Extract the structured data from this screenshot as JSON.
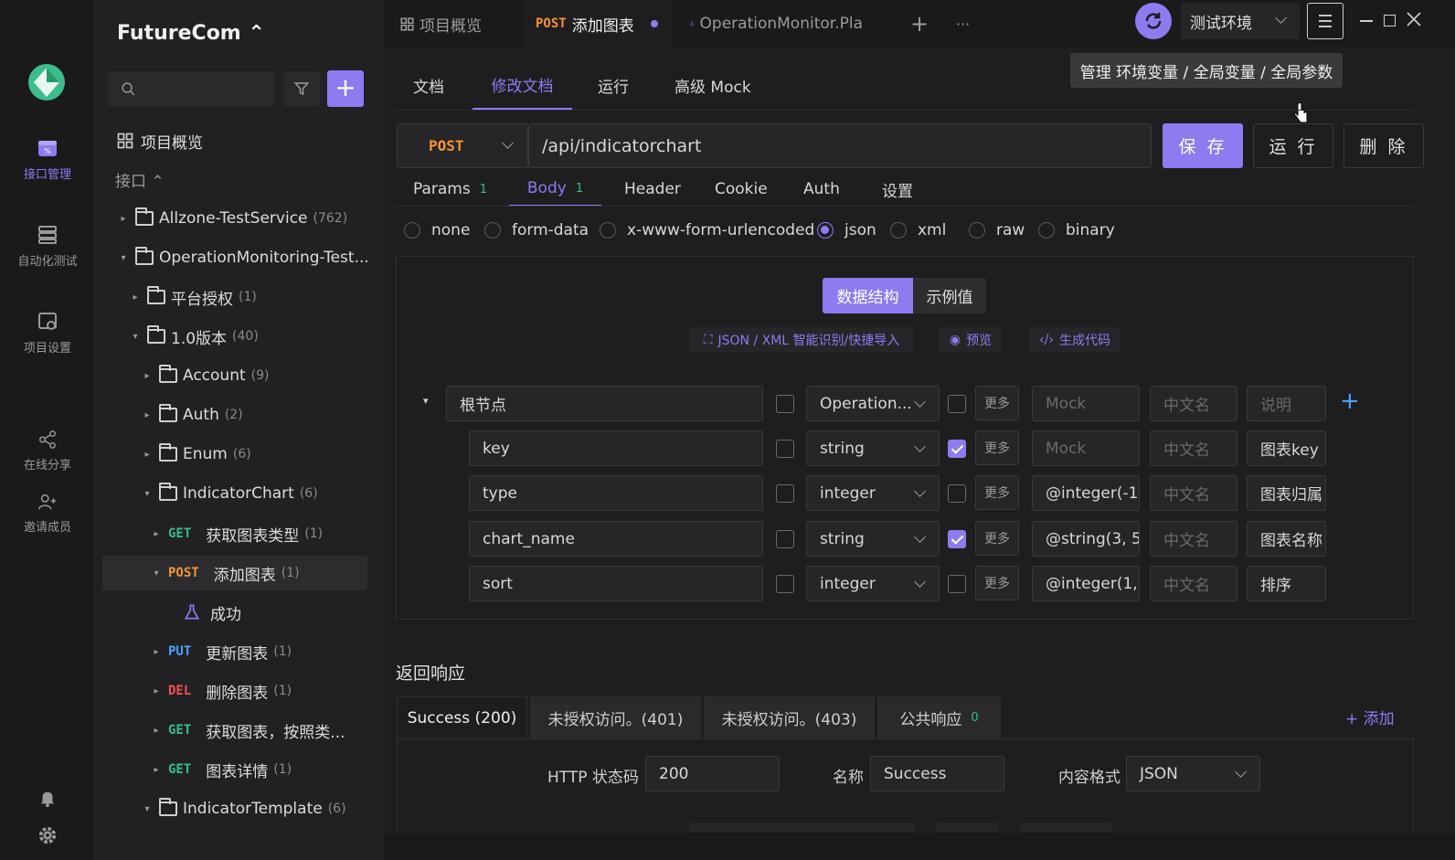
{
  "leftbar": {
    "items": [
      {
        "label": "接口管理",
        "icon": "api-management-icon"
      },
      {
        "label": "自动化测试",
        "icon": "automation-test-icon"
      },
      {
        "label": "项目设置",
        "icon": "project-settings-icon"
      },
      {
        "label": "在线分享",
        "icon": "share-icon"
      },
      {
        "label": "邀请成员",
        "icon": "invite-member-icon"
      }
    ]
  },
  "tree": {
    "project_name": "FutureCom ⌃",
    "search_placeholder": "",
    "overview": "项目概览",
    "api_section": "接口 ⌃",
    "rows": [
      {
        "kind": "folder",
        "arrow": "▸",
        "label": "Allzone-TestService",
        "count": "(762)"
      },
      {
        "kind": "folder",
        "arrow": "▾",
        "label": "OperationMonitoring-Test...",
        "count": ""
      },
      {
        "kind": "folder",
        "arrow": "▸",
        "label": "平台授权",
        "count": "(1)"
      },
      {
        "kind": "folder",
        "arrow": "▾",
        "label": "1.0版本",
        "count": "(40)"
      },
      {
        "kind": "folder",
        "arrow": "▸",
        "label": "Account",
        "count": "(9)"
      },
      {
        "kind": "folder",
        "arrow": "▸",
        "label": "Auth",
        "count": "(2)"
      },
      {
        "kind": "folder",
        "arrow": "▸",
        "label": "Enum",
        "count": "(6)"
      },
      {
        "kind": "folder",
        "arrow": "▾",
        "label": "IndicatorChart",
        "count": "(6)"
      },
      {
        "kind": "api",
        "arrow": "▸",
        "method": "GET",
        "label": "获取图表类型",
        "count": "(1)"
      },
      {
        "kind": "api",
        "arrow": "▾",
        "method": "POST",
        "label": "添加图表",
        "count": "(1)"
      },
      {
        "kind": "case",
        "arrow": "",
        "label": "成功",
        "count": ""
      },
      {
        "kind": "api",
        "arrow": "▸",
        "method": "PUT",
        "label": "更新图表",
        "count": "(1)"
      },
      {
        "kind": "api",
        "arrow": "▸",
        "method": "DEL",
        "label": "删除图表",
        "count": "(1)"
      },
      {
        "kind": "api",
        "arrow": "▸",
        "method": "GET",
        "label": "获取图表，按照类...",
        "count": ""
      },
      {
        "kind": "api",
        "arrow": "▸",
        "method": "GET",
        "label": "图表详情",
        "count": "(1)"
      },
      {
        "kind": "folder",
        "arrow": "▾",
        "label": "IndicatorTemplate",
        "count": "(6)"
      }
    ]
  },
  "tabs": {
    "t1": "项目概览",
    "t2_method": "POST",
    "t2_label": "添加图表",
    "t3": "OperationMonitor.Pla",
    "add": "+",
    "more": "···"
  },
  "env": {
    "name": "测试环境",
    "tooltip": "管理 环境变量 / 全局变量 / 全局参数"
  },
  "subtabs": [
    "文档",
    "修改文档",
    "运行",
    "高级 Mock"
  ],
  "request": {
    "method": "POST",
    "url": "/api/indicatorchart",
    "save": "保 存",
    "run": "运 行",
    "delete": "删 除"
  },
  "paramtabs": [
    {
      "label": "Params",
      "badge": "1"
    },
    {
      "label": "Body",
      "badge": "1"
    },
    {
      "label": "Header",
      "badge": ""
    },
    {
      "label": "Cookie",
      "badge": ""
    },
    {
      "label": "Auth",
      "badge": ""
    },
    {
      "label": "设置",
      "badge": ""
    }
  ],
  "body_types": [
    "none",
    "form-data",
    "x-www-form-urlencoded",
    "json",
    "xml",
    "raw",
    "binary"
  ],
  "body_selected": "json",
  "schema": {
    "toggle_struct": "数据结构",
    "toggle_example": "示例值",
    "import": "JSON / XML 智能识别/快捷导入",
    "preview": "预览",
    "gencode": "生成代码",
    "more": "更多",
    "mock_ph": "Mock",
    "cn_ph": "中文名",
    "desc_ph": "说明",
    "root": {
      "name": "根节点",
      "type": "Operation..."
    },
    "fields": [
      {
        "name": "key",
        "type": "string",
        "required": true,
        "mock": "",
        "desc": "图表key"
      },
      {
        "name": "type",
        "type": "integer",
        "required": false,
        "mock": "@integer(-1",
        "desc": "图表归属"
      },
      {
        "name": "chart_name",
        "type": "string",
        "required": true,
        "mock": "@string(3, 5",
        "desc": "图表名称"
      },
      {
        "name": "sort",
        "type": "integer",
        "required": false,
        "mock": "@integer(1,",
        "desc": "排序"
      }
    ]
  },
  "response": {
    "title": "返回响应",
    "tabs": [
      {
        "label": "Success (200)"
      },
      {
        "label": "未授权访问。(401)"
      },
      {
        "label": "未授权访问。(403)"
      },
      {
        "label": "公共响应",
        "badge": "0"
      }
    ],
    "add": "+ 添加",
    "status_label": "HTTP 状态码",
    "status_value": "200",
    "name_label": "名称",
    "name_value": "Success",
    "format_label": "内容格式",
    "format_value": "JSON"
  },
  "colors": {
    "accent": "#8c7cf0",
    "post": "#f59434",
    "get": "#3bbd8a",
    "put": "#4aa2ff",
    "del": "#f0534f"
  }
}
